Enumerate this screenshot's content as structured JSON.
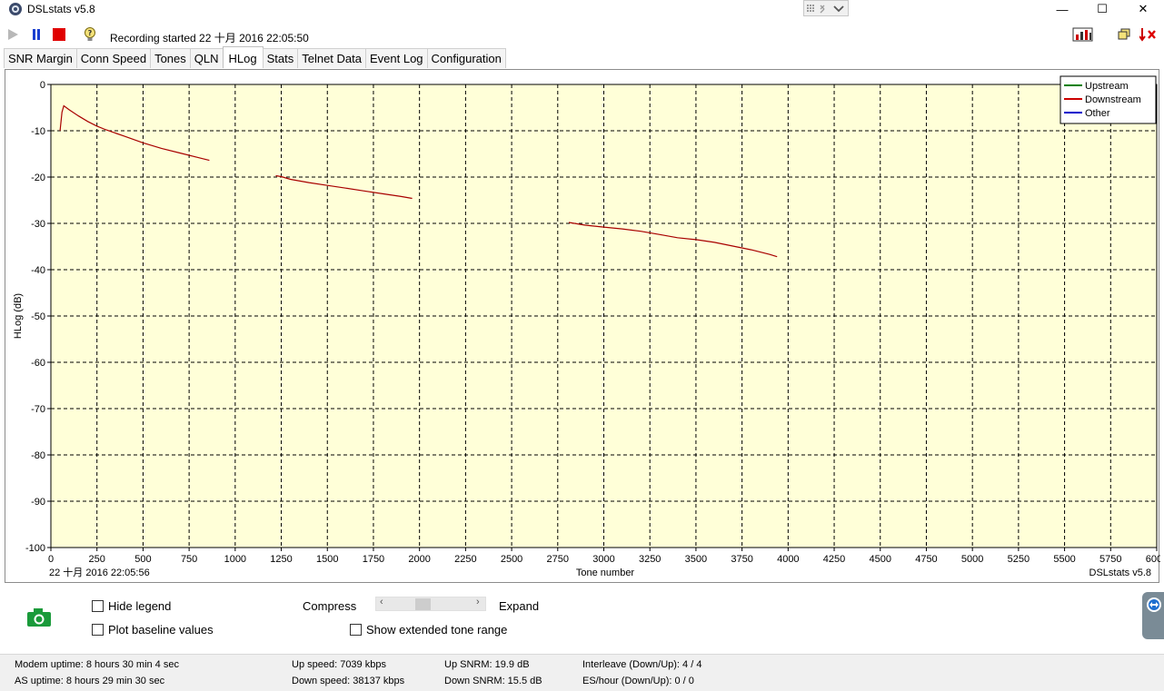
{
  "window": {
    "title": "DSLstats v5.8",
    "minimize": "—",
    "maximize": "☐",
    "close": "✕"
  },
  "toolbar": {
    "recording_text": "Recording started 22 十月 2016 22:05:50"
  },
  "tabs": [
    {
      "label": "SNR Margin",
      "active": false
    },
    {
      "label": "Conn Speed",
      "active": false
    },
    {
      "label": "Tones",
      "active": false
    },
    {
      "label": "QLN",
      "active": false
    },
    {
      "label": "HLog",
      "active": true
    },
    {
      "label": "Stats",
      "active": false
    },
    {
      "label": "Telnet Data",
      "active": false
    },
    {
      "label": "Event Log",
      "active": false
    },
    {
      "label": "Configuration",
      "active": false
    }
  ],
  "chart_footer": {
    "timestamp": "22 十月 2016 22:05:56",
    "watermark": "DSLstats v5.8"
  },
  "chart_data": {
    "type": "line",
    "ylabel": "HLog (dB)",
    "xlabel": "Tone number",
    "xlim": [
      0,
      6000
    ],
    "ylim": [
      -100,
      0
    ],
    "x_ticks": [
      0,
      250,
      500,
      750,
      1000,
      1250,
      1500,
      1750,
      2000,
      2250,
      2500,
      2750,
      3000,
      3250,
      3500,
      3750,
      4000,
      4250,
      4500,
      4750,
      5000,
      5250,
      5500,
      5750,
      6000
    ],
    "y_ticks": [
      0,
      -10,
      -20,
      -30,
      -40,
      -50,
      -60,
      -70,
      -80,
      -90,
      -100
    ],
    "grid": true,
    "legend_position": "top-right",
    "legend": [
      {
        "name": "Upstream",
        "color": "#008000"
      },
      {
        "name": "Downstream",
        "color": "#cc0000"
      },
      {
        "name": "Other",
        "color": "#0000cc"
      }
    ],
    "series": [
      {
        "name": "Downstream",
        "color": "#a80000",
        "segments": [
          [
            [
              50,
              -10
            ],
            [
              60,
              -6
            ],
            [
              70,
              -4.6
            ],
            [
              100,
              -5.5
            ],
            [
              150,
              -6.8
            ],
            [
              200,
              -8
            ],
            [
              250,
              -9
            ],
            [
              300,
              -9.8
            ],
            [
              400,
              -11.2
            ],
            [
              500,
              -12.6
            ],
            [
              600,
              -13.8
            ],
            [
              700,
              -14.8
            ],
            [
              800,
              -15.8
            ],
            [
              860,
              -16.4
            ]
          ],
          [
            [
              1220,
              -19.7
            ],
            [
              1250,
              -19.9
            ],
            [
              1300,
              -20.5
            ],
            [
              1400,
              -21.2
            ],
            [
              1500,
              -21.8
            ],
            [
              1600,
              -22.4
            ],
            [
              1700,
              -23
            ],
            [
              1800,
              -23.6
            ],
            [
              1900,
              -24.2
            ],
            [
              1960,
              -24.6
            ]
          ],
          [
            [
              2810,
              -29.8
            ],
            [
              2900,
              -30.4
            ],
            [
              3000,
              -30.8
            ],
            [
              3100,
              -31.2
            ],
            [
              3200,
              -31.7
            ],
            [
              3300,
              -32.4
            ],
            [
              3400,
              -33.1
            ],
            [
              3500,
              -33.5
            ],
            [
              3600,
              -34.1
            ],
            [
              3700,
              -34.9
            ],
            [
              3800,
              -35.7
            ],
            [
              3900,
              -36.7
            ],
            [
              3940,
              -37.2
            ]
          ]
        ]
      }
    ]
  },
  "controls": {
    "hide_legend": "Hide legend",
    "plot_baseline": "Plot baseline values",
    "compress": "Compress",
    "expand": "Expand",
    "show_extended": "Show extended tone range"
  },
  "status": {
    "modem_uptime": "Modem uptime:  8 hours 30 min 4 sec",
    "as_uptime": "AS uptime:  8 hours 29 min 30 sec",
    "up_speed": "Up speed: 7039 kbps",
    "down_speed": "Down speed: 38137 kbps",
    "up_snrm": "Up SNRM: 19.9 dB",
    "down_snrm": "Down SNRM: 15.5 dB",
    "interleave": "Interleave (Down/Up): 4 / 4",
    "es_hour": "ES/hour (Down/Up): 0 / 0"
  }
}
